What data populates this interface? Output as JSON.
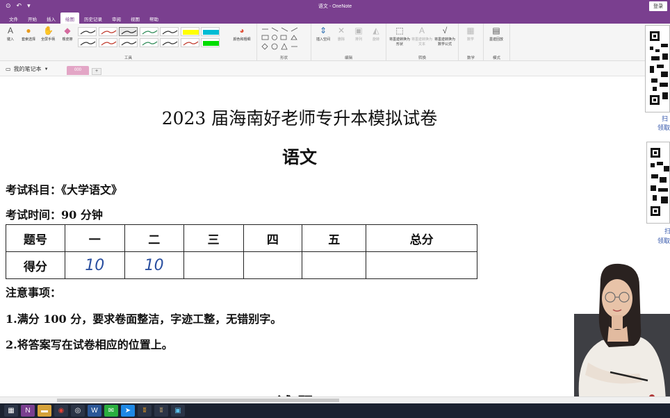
{
  "window": {
    "title": "语文 - OneNote",
    "signin": "登录",
    "quick_access": [
      "⊙",
      "↶",
      "▾"
    ]
  },
  "tabs": [
    "文件",
    "开始",
    "插入",
    "绘图",
    "历史记录",
    "审阅",
    "视图",
    "帮助"
  ],
  "active_tab": "绘图",
  "ribbon": {
    "groups": {
      "tools": "工具",
      "shapes": "形状",
      "edit": "编辑",
      "convert": "转换",
      "math": "数学",
      "mode": "模式"
    },
    "buttons": {
      "type": "键入",
      "lasso": "套索选择",
      "pan": "全屏手柄",
      "eraser": "橡皮擦",
      "color_thickness": "颜色和粗细",
      "insert_space": "插入空间",
      "delete": "删除",
      "arrange": "排列",
      "rotate": "旋转",
      "ink_to_shape": "将墨迹转换为形状",
      "ink_to_text": "将墨迹转换为文本",
      "ink_to_math": "将墨迹转换为数学公式",
      "math": "数学",
      "replay": "墨迹回放"
    },
    "pen_colors": [
      "#333333",
      "#c0392b",
      "#333333",
      "#2e8b57",
      "#333333",
      "#ffff00",
      "#00bcd4",
      "#333333",
      "#c0392b",
      "#333333",
      "#2e8b57",
      "#333333",
      "#c0392b",
      "#00dd00"
    ]
  },
  "notebook": {
    "name": "我的笔记本",
    "section": "000",
    "add": "+"
  },
  "document": {
    "title": "2023 届海南好老师专升本模拟试卷",
    "subject": "语文",
    "exam_subject": "考试科目：《大学语文》",
    "exam_time": "考试时间：90 分钟",
    "table": {
      "headers": [
        "题号",
        "一",
        "二",
        "三",
        "四",
        "五",
        "总分"
      ],
      "row_label": "得分",
      "scores": [
        "10",
        "10",
        "",
        "",
        "",
        ""
      ]
    },
    "notes_title": "注意事项：",
    "notes": [
      "1.满分 100 分，要求卷面整洁，字迹工整，无错别字。",
      "2.将答案写在试卷相应的位置上。"
    ],
    "cutoff_heading": "试 题"
  },
  "qr_labels": [
    "扫",
    "领取",
    "扫",
    "领取"
  ],
  "colors": {
    "brand": "#7a3f8f",
    "handwriting": "#2a4fa0",
    "section_tab": "#e3a6c6"
  }
}
